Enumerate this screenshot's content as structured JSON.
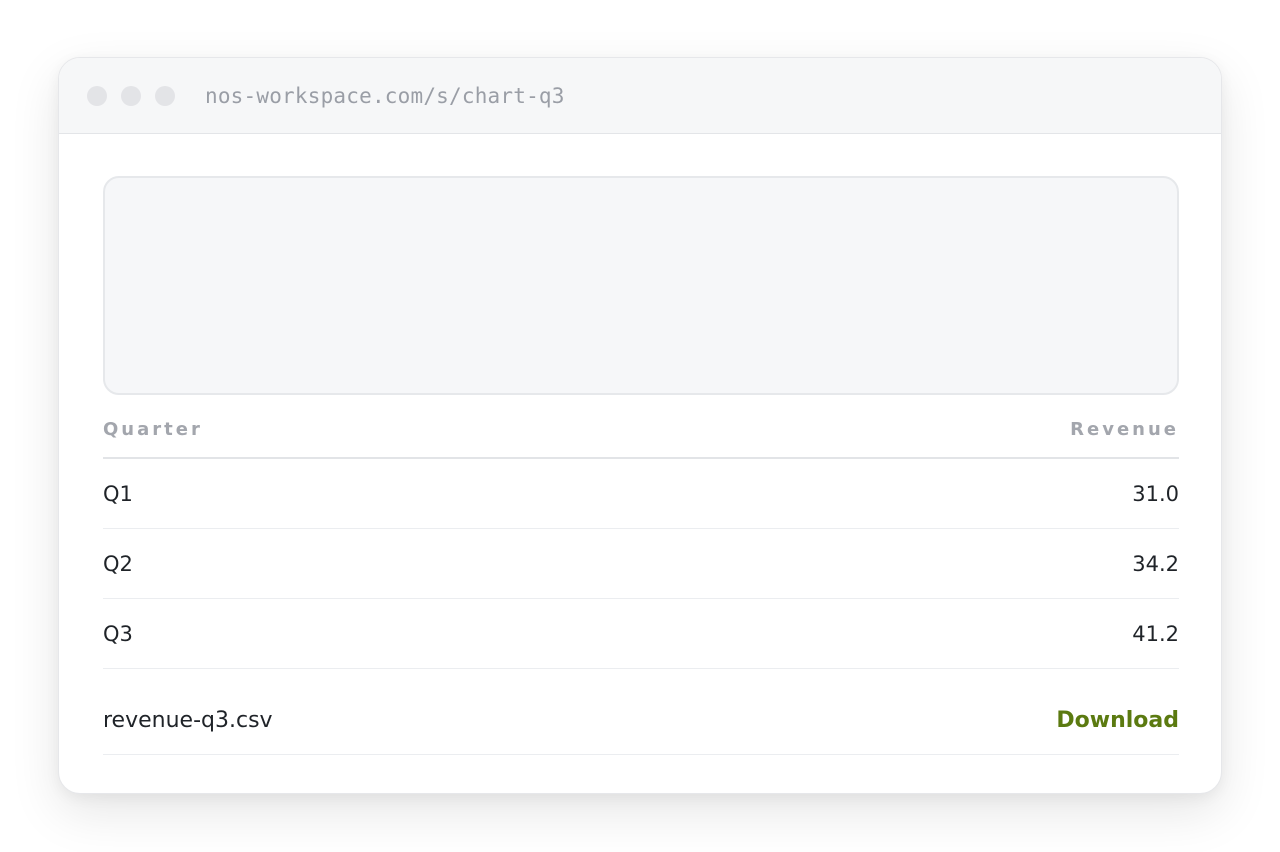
{
  "browser": {
    "url": "nos-workspace.com/s/chart-q3"
  },
  "table": {
    "headers": {
      "quarter": "Quarter",
      "revenue": "Revenue"
    },
    "rows": [
      {
        "quarter": "Q1",
        "revenue": "31.0"
      },
      {
        "quarter": "Q2",
        "revenue": "34.2"
      },
      {
        "quarter": "Q3",
        "revenue": "41.2"
      }
    ]
  },
  "attachment": {
    "filename": "revenue-q3.csv",
    "action_label": "Download",
    "action_color": "#5b7a10"
  }
}
